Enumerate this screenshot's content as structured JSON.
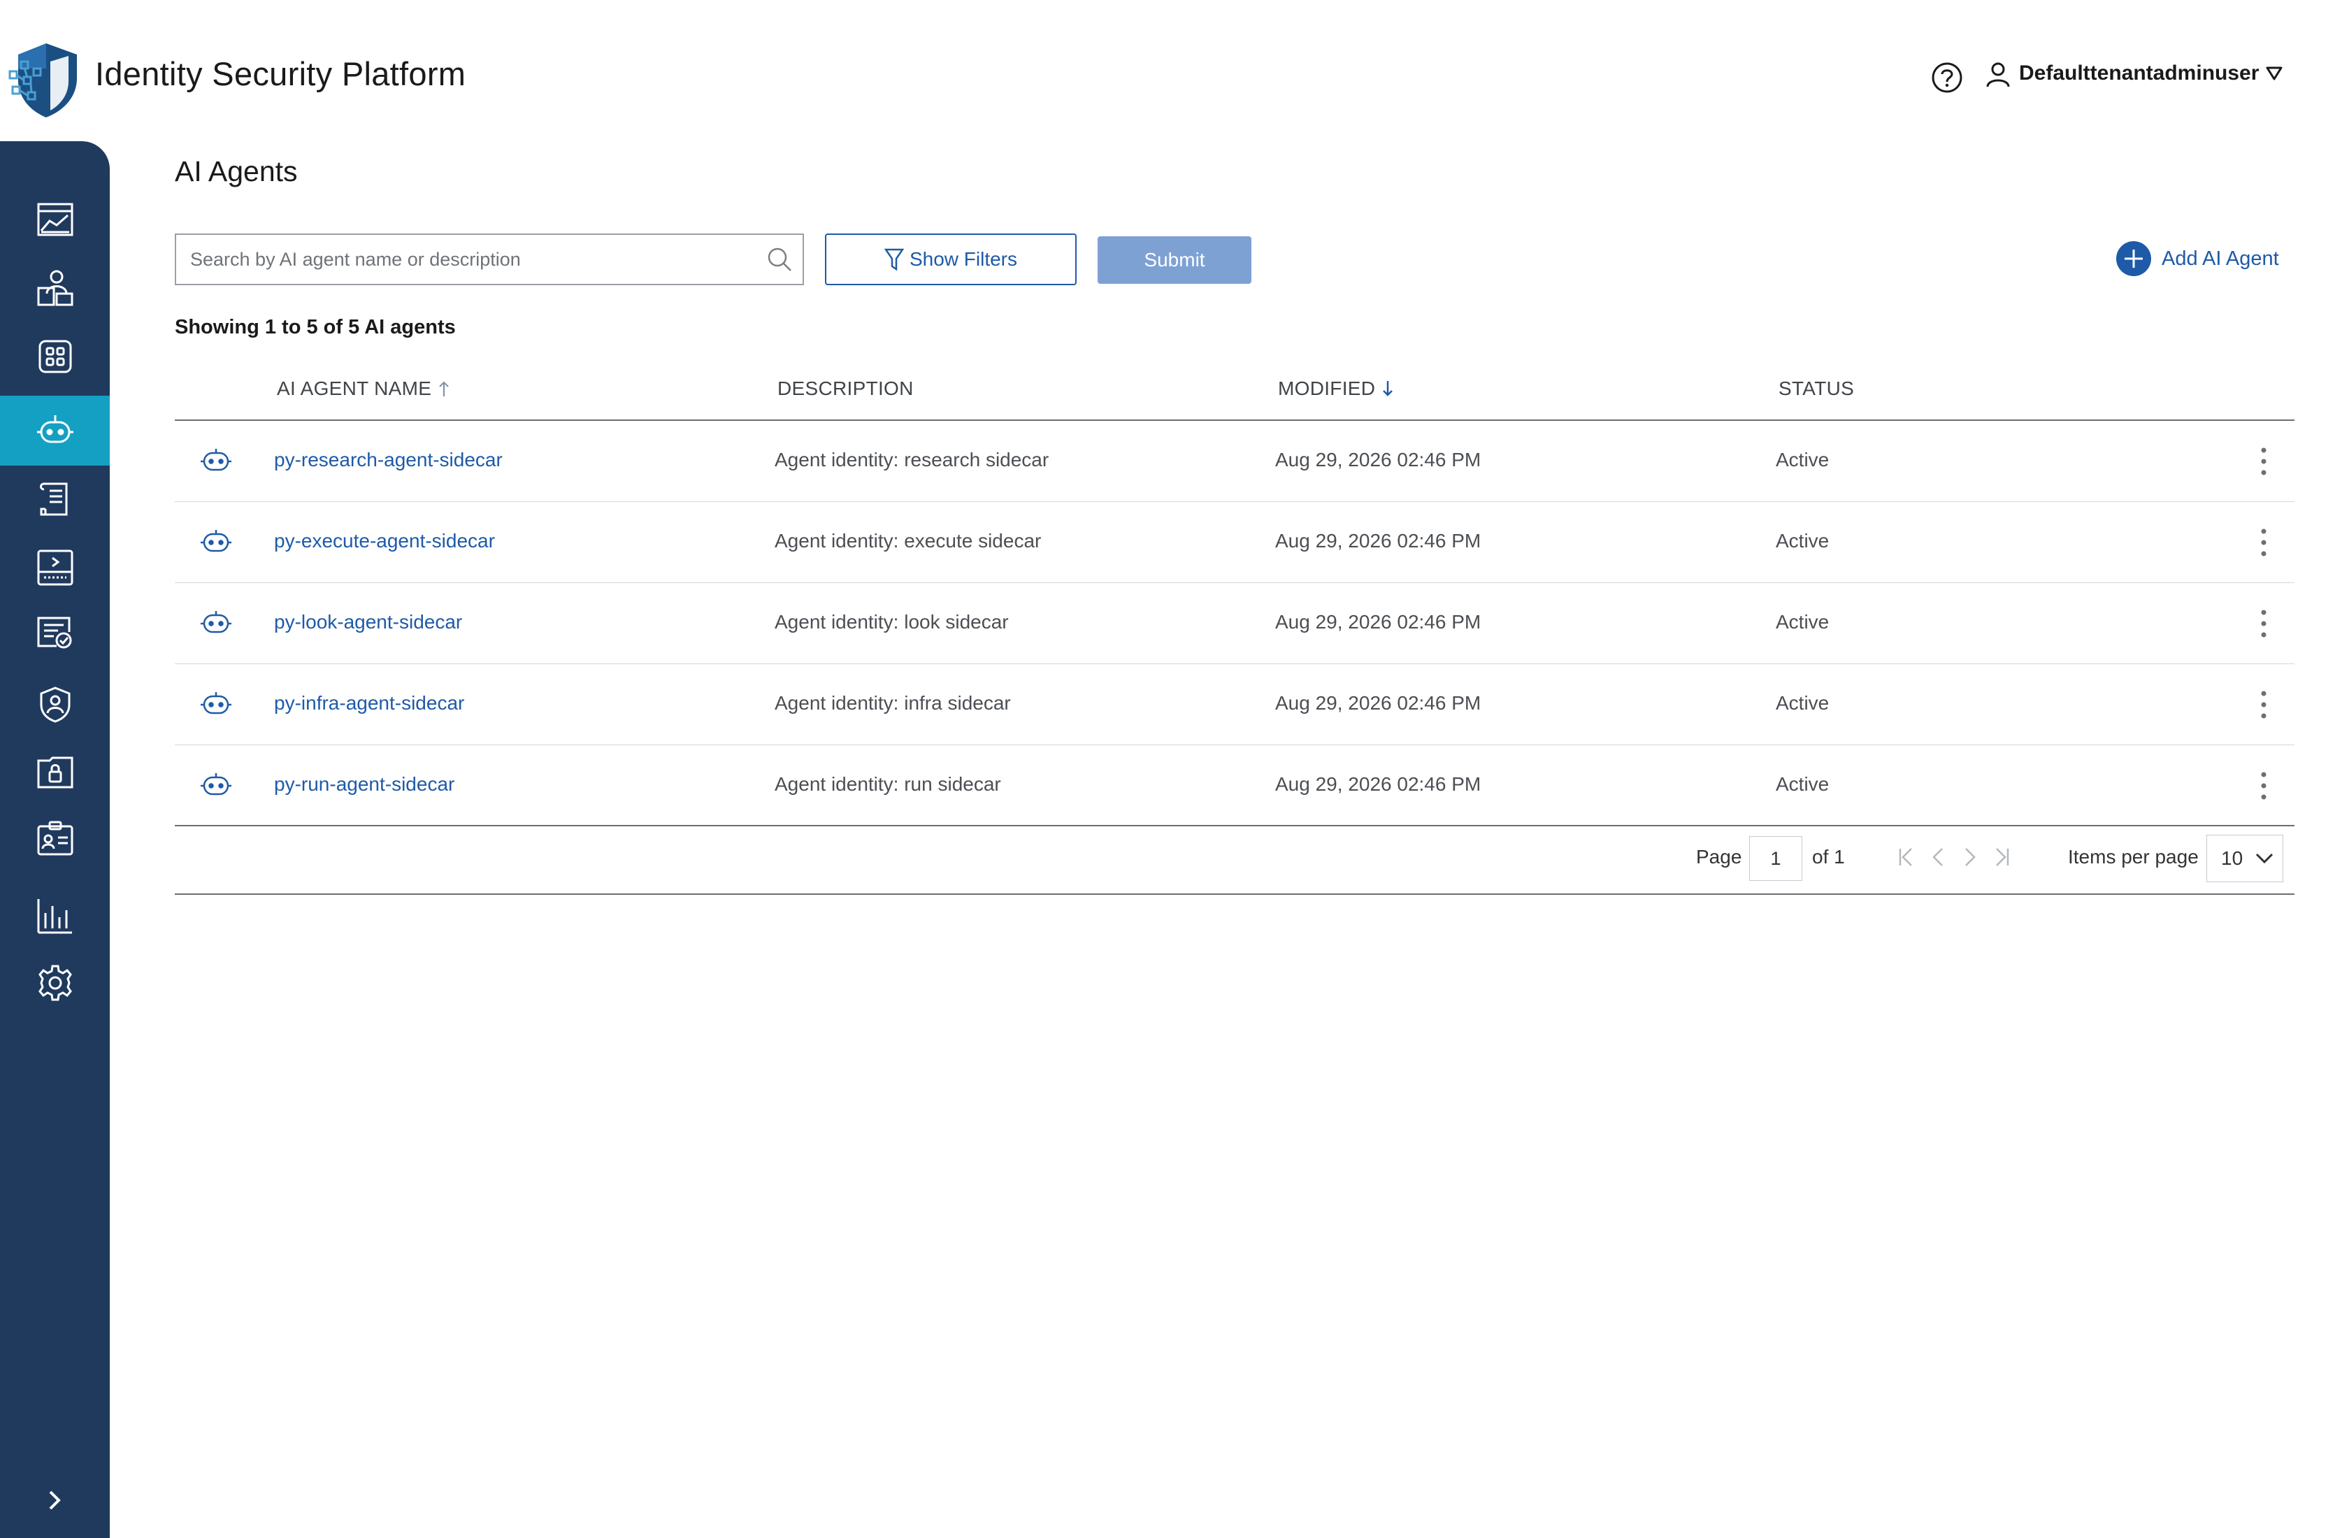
{
  "header": {
    "app_title": "Identity Security Platform",
    "user_name": "Defaulttenantadminuser",
    "icons": [
      "help-icon",
      "user-icon",
      "caret-down-icon"
    ]
  },
  "sidebar": {
    "items": [
      {
        "name": "dashboard",
        "icon": "dashboard-icon",
        "active": false
      },
      {
        "name": "identities",
        "icon": "users-icon",
        "active": false
      },
      {
        "name": "applications",
        "icon": "apps-grid-icon",
        "active": false
      },
      {
        "name": "ai-agents",
        "icon": "robot-icon",
        "active": true
      },
      {
        "name": "policies",
        "icon": "scroll-icon",
        "active": false
      },
      {
        "name": "devices",
        "icon": "terminal-icon",
        "active": false
      },
      {
        "name": "certifications",
        "icon": "certificate-icon",
        "active": false
      },
      {
        "name": "security",
        "icon": "shield-user-icon",
        "active": false
      },
      {
        "name": "vault",
        "icon": "lock-folder-icon",
        "active": false
      },
      {
        "name": "id-cards",
        "icon": "id-card-icon",
        "active": false
      },
      {
        "name": "reports",
        "icon": "bar-chart-icon",
        "active": false
      },
      {
        "name": "settings",
        "icon": "gear-icon",
        "active": false
      }
    ],
    "expand_icon": "chevron-right-icon"
  },
  "main": {
    "page_title": "AI Agents",
    "search": {
      "placeholder": "Search by AI agent name or description",
      "value": ""
    },
    "filters_label": "Show Filters",
    "submit_label": "Submit",
    "add_label": "Add AI Agent",
    "showing_text": "Showing 1 to 5 of 5 AI agents",
    "columns": [
      {
        "label": "AI AGENT NAME",
        "sort": "asc"
      },
      {
        "label": "DESCRIPTION",
        "sort": ""
      },
      {
        "label": "MODIFIED",
        "sort": "desc"
      },
      {
        "label": "STATUS",
        "sort": ""
      }
    ],
    "rows": [
      {
        "name": "py-research-agent-sidecar",
        "description": "Agent identity: research sidecar",
        "modified": "Aug 29, 2026 02:46 PM",
        "status": "Active"
      },
      {
        "name": "py-execute-agent-sidecar",
        "description": "Agent identity: execute sidecar",
        "modified": "Aug 29, 2026 02:46 PM",
        "status": "Active"
      },
      {
        "name": "py-look-agent-sidecar",
        "description": "Agent identity: look sidecar",
        "modified": "Aug 29, 2026 02:46 PM",
        "status": "Active"
      },
      {
        "name": "py-infra-agent-sidecar",
        "description": "Agent identity: infra sidecar",
        "modified": "Aug 29, 2026 02:46 PM",
        "status": "Active"
      },
      {
        "name": "py-run-agent-sidecar",
        "description": "Agent identity: run sidecar",
        "modified": "Aug 29, 2026 02:46 PM",
        "status": "Active"
      }
    ],
    "pagination": {
      "page_label": "Page",
      "page_value": "1",
      "of_label": "of 1",
      "items_per_page_label": "Items per page",
      "items_per_page_value": "10"
    }
  },
  "colors": {
    "sidebar_bg": "#203a5e",
    "sidebar_active": "#14a0c2",
    "primary": "#1e5aa8",
    "submit_disabled": "#7ea1d4"
  }
}
